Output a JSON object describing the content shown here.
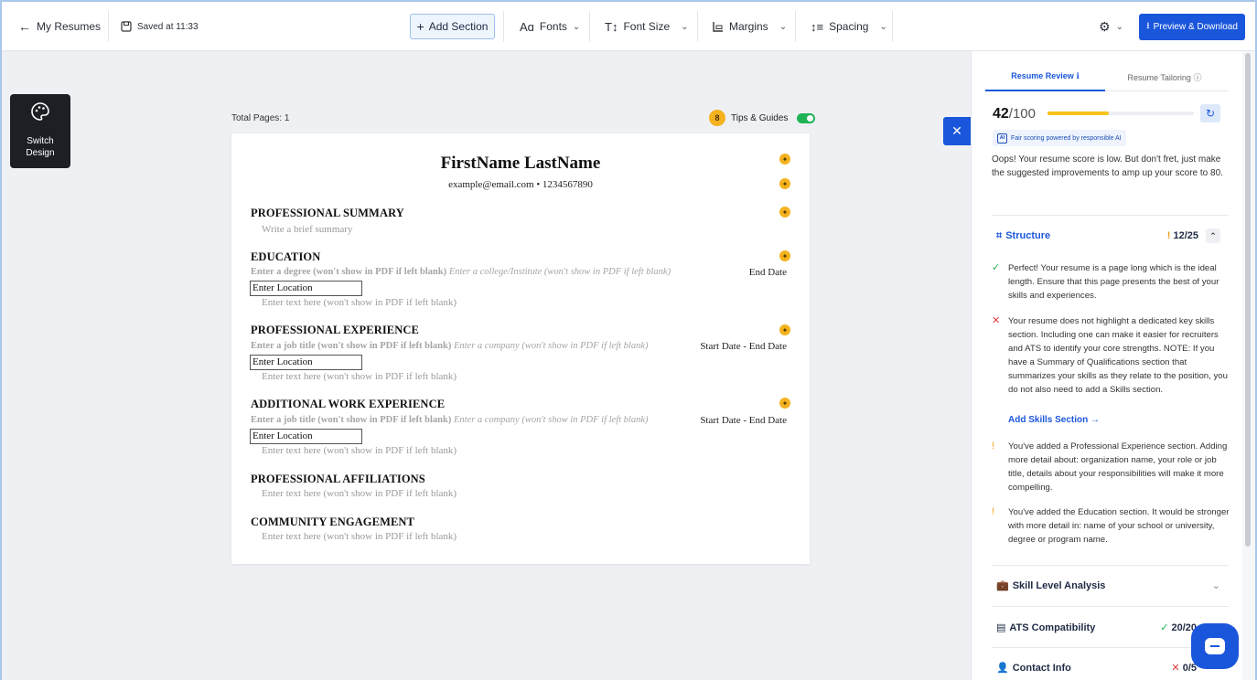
{
  "toolbar": {
    "back_label": "My Resumes",
    "saved_label": "Saved at 11:33",
    "add_section_label": "Add Section",
    "fonts_label": "Fonts",
    "font_size_label": "Font Size",
    "margins_label": "Margins",
    "spacing_label": "Spacing",
    "preview_label": "Preview & Download"
  },
  "switch_design": {
    "line1": "Switch",
    "line2": "Design"
  },
  "canvas": {
    "total_pages": "Total Pages: 1",
    "tips_count": "8",
    "tips_label": "Tips & Guides",
    "tips_enabled": true
  },
  "resume": {
    "name": "FirstName LastName",
    "contact": "example@email.com • 1234567890",
    "summary_title": "PROFESSIONAL SUMMARY",
    "summary_placeholder": "Write a brief summary",
    "education": {
      "title": "EDUCATION",
      "degree": "Enter a degree (won't show in PDF if left blank)",
      "college": "Enter a college/Institute (won't show in PDF if left blank)",
      "end_date": "End Date",
      "location": "Enter Location",
      "text": "Enter text here (won't show in PDF if left blank)"
    },
    "experience": {
      "title": "PROFESSIONAL EXPERIENCE",
      "job": "Enter a job title (won't show in PDF if left blank)",
      "company": "Enter a company (won't show in PDF if left blank)",
      "dates": "Start Date  -  End Date",
      "location": "Enter Location",
      "text": "Enter text here (won't show in PDF if left blank)"
    },
    "additional": {
      "title": "ADDITIONAL WORK EXPERIENCE",
      "job": "Enter a job title (won't show in PDF if left blank)",
      "company": "Enter a company (won't show in PDF if left blank)",
      "dates": "Start Date  -  End Date",
      "location": "Enter Location",
      "text": "Enter text here (won't show in PDF if left blank)"
    },
    "affiliations": {
      "title": "PROFESSIONAL AFFILIATIONS",
      "text": "Enter text here (won't show in PDF if left blank)"
    },
    "community": {
      "title": "COMMUNITY ENGAGEMENT",
      "text": "Enter text here (won't show in PDF if left blank)"
    }
  },
  "panel": {
    "tab_review": "Resume Review",
    "tab_tailoring": "Resume Tailoring",
    "score": "42",
    "score_max": "/100",
    "score_fraction": 0.42,
    "fair_label": "Fair scoring powered by responsible AI",
    "ai_badge": "AI",
    "oops_text": "Oops! Your resume score is low. But don't fret, just make the suggested improvements to amp up your score to 80.",
    "structure": {
      "label": "Structure",
      "value": "12/25",
      "items": [
        {
          "status": "ok",
          "text": "Perfect! Your resume is a page long which is the ideal length. Ensure that this page presents the best of your skills and experiences."
        },
        {
          "status": "error",
          "text": "Your resume does not highlight a dedicated key skills section. Including one can make it easier for recruiters and ATS to identify your core strengths. NOTE: If you have a Summary of Qualifications section that summarizes your skills as they relate to the position, you do not also need to add a Skills section."
        },
        {
          "status": "warn",
          "text": "You've added a Professional Experience section. Adding more detail about: organization name, your role or job title, details about your responsibilities will make it more compelling."
        },
        {
          "status": "warn",
          "text": "You've added the Education section. It would be stronger with more detail in: name of your school or university, degree or program name."
        }
      ],
      "add_skills_link": "Add Skills Section →"
    },
    "skill_level": {
      "label": "Skill Level Analysis"
    },
    "ats": {
      "label": "ATS Compatibility",
      "value": "20/20"
    },
    "contact": {
      "label": "Contact Info",
      "value": "0/5"
    }
  },
  "colors": {
    "accent": "#1a56db",
    "bulb": "#f4b21e",
    "success": "#1fb256",
    "error": "#e23b3b",
    "warning": "#f4a21e"
  }
}
